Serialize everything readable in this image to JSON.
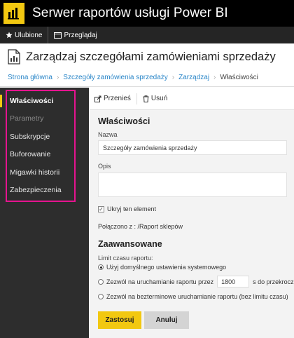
{
  "app": {
    "title": "Serwer raportów usługi Power BI",
    "logo_icon": "power-bi-logo-icon",
    "brand_color": "#f2c811"
  },
  "nav": {
    "favorites": {
      "label": "Ulubione",
      "icon": "star-icon"
    },
    "browse": {
      "label": "Przeglądaj",
      "icon": "folder-icon"
    }
  },
  "page": {
    "title": "Zarządzaj szczegółami zamówieniami sprzedaży",
    "icon": "report-icon",
    "breadcrumb": {
      "items": [
        "Strona główna",
        "Szczegóły zamówienia sprzedaży",
        "Zarządzaj"
      ],
      "current": "Właściwości"
    }
  },
  "sidebar": {
    "items": [
      {
        "label": "Właściwości",
        "state": "active"
      },
      {
        "label": "Parametry",
        "state": "disabled"
      },
      {
        "label": "Subskrypcje",
        "state": "normal"
      },
      {
        "label": "Buforowanie",
        "state": "normal"
      },
      {
        "label": "Migawki historii",
        "state": "normal"
      },
      {
        "label": "Zabezpieczenia",
        "state": "normal"
      }
    ],
    "highlight_color": "#e5148f"
  },
  "toolbar": {
    "move": {
      "label": "Przenieś",
      "icon": "move-icon"
    },
    "delete": {
      "label": "Usuń",
      "icon": "trash-icon"
    }
  },
  "properties": {
    "section_title": "Właściwości",
    "name_label": "Nazwa",
    "name_value": "Szczegóły zamówienia sprzedaży",
    "description_label": "Opis",
    "description_value": "",
    "hide_label": "Ukryj ten element",
    "hide_checked": true,
    "connected_text": "Połączono z : /Raport sklepów"
  },
  "advanced": {
    "section_title": "Zaawansowane",
    "timeout_label": "Limit czasu raportu:",
    "option_default": "Użyj domyślnego ustawienia systemowego",
    "option_allow_prefix": "Zezwól na uruchamianie raportu przez",
    "timeout_value": "1800",
    "option_allow_suffix": "s do przekroczenia",
    "option_unlimited": "Zezwól na bezterminowe uruchamianie raportu (bez limitu czasu)",
    "selected_option": "default"
  },
  "actions": {
    "apply_label": "Zastosuj",
    "cancel_label": "Anuluj"
  }
}
